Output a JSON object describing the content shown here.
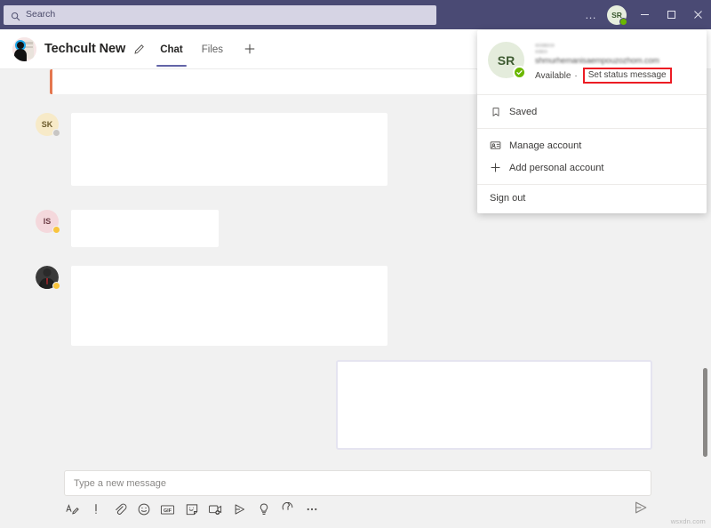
{
  "window": {
    "app_background": "#f1f1f1",
    "titlebar_color": "#4a4a74",
    "accent_color": "#6264a7",
    "annotation_color": "#ec1c24"
  },
  "titlebar": {
    "search_placeholder": "Search",
    "search_icon": "search-icon",
    "more_label": "…",
    "avatar_initials": "SR",
    "presence": "Available",
    "minimize_label": "Minimize",
    "maximize_label": "Maximize",
    "close_label": "Close"
  },
  "header": {
    "team_name": "Techcult New",
    "edit_icon": "pencil-icon",
    "add_tab_label": "+",
    "tabs": [
      {
        "label": "Chat",
        "active": true
      },
      {
        "label": "Files",
        "active": false
      }
    ]
  },
  "chat": {
    "messages": [
      {
        "id": "m0",
        "author_initials": "",
        "avatar_type": "none",
        "urgent": true,
        "side": "left"
      },
      {
        "id": "m1",
        "author_initials": "SK",
        "avatar_type": "initials",
        "avatar_bg": "#f7eac8",
        "avatar_fg": "#6b5a2b",
        "presence_color": "#c8c6c4",
        "urgent": false,
        "side": "left"
      },
      {
        "id": "m2",
        "author_initials": "IS",
        "avatar_type": "initials",
        "avatar_bg": "#f4d8dc",
        "avatar_fg": "#6b3a42",
        "presence_color": "#f8c43d",
        "urgent": false,
        "side": "left"
      },
      {
        "id": "m3",
        "author_initials": "",
        "avatar_type": "photo",
        "presence_color": "#f8c43d",
        "urgent": false,
        "side": "left"
      },
      {
        "id": "m4",
        "author_initials": "",
        "avatar_type": "none",
        "urgent": false,
        "side": "right",
        "read_receipt": "seen-icon"
      }
    ]
  },
  "compose": {
    "placeholder": "Type a new message",
    "send_icon": "send-icon",
    "tools": [
      {
        "name": "format-icon",
        "label": "Format"
      },
      {
        "name": "importance-icon",
        "label": "Set delivery options"
      },
      {
        "name": "attach-icon",
        "label": "Attach"
      },
      {
        "name": "emoji-icon",
        "label": "Emoji"
      },
      {
        "name": "giphy-icon",
        "label": "Giphy"
      },
      {
        "name": "sticker-icon",
        "label": "Sticker"
      },
      {
        "name": "meet-now-icon",
        "label": "Meet now"
      },
      {
        "name": "stream-icon",
        "label": "Stream"
      },
      {
        "name": "praise-icon",
        "label": "Praise"
      },
      {
        "name": "approvals-icon",
        "label": "Approvals"
      },
      {
        "name": "more-options-icon",
        "label": "More options"
      }
    ]
  },
  "profile_menu": {
    "avatar_initials": "SR",
    "email_masked": "shmurhemanisaempouzozhom.com",
    "status_label": "Available",
    "status_separator": "·",
    "set_status_label": "Set status message",
    "items": [
      {
        "label": "Saved",
        "icon": "bookmark-icon"
      },
      {
        "label": "Manage account",
        "icon": "id-card-icon"
      },
      {
        "label": "Add personal account",
        "icon": "plus-icon"
      }
    ],
    "sign_out_label": "Sign out"
  },
  "watermark": {
    "text": "wsxdn.com"
  }
}
